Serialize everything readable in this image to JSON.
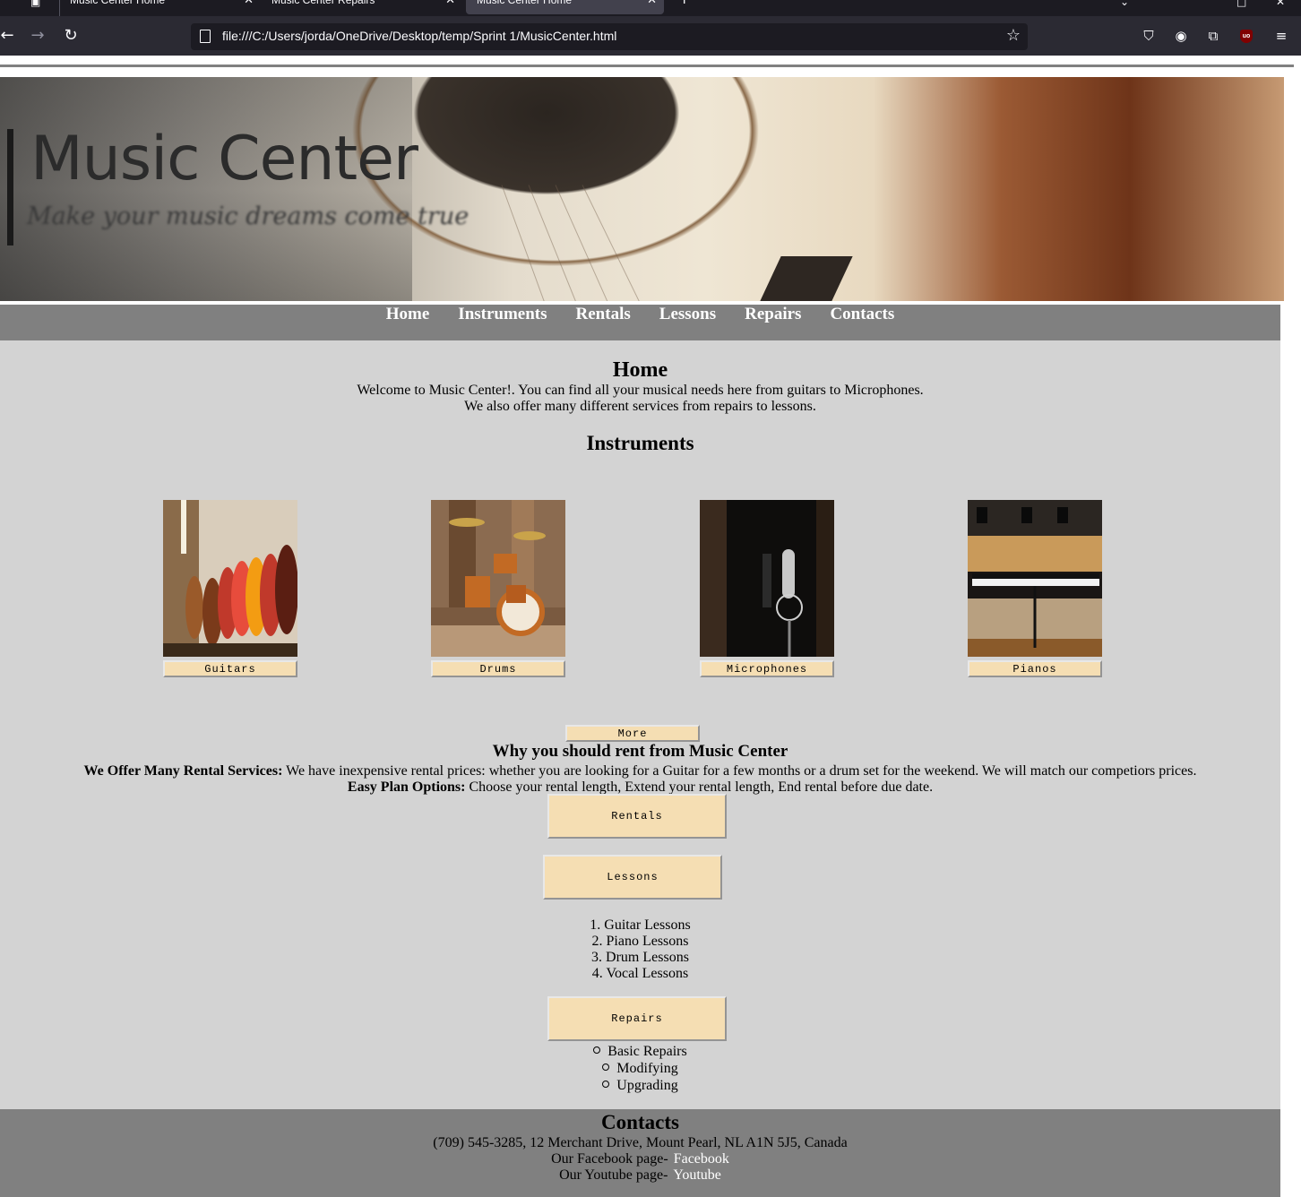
{
  "browser": {
    "tabs": [
      {
        "title": "Music Center Home",
        "active": false
      },
      {
        "title": "Music Center Repairs",
        "active": false
      },
      {
        "title": "Music Center Home",
        "active": true
      }
    ],
    "close_glyph": "✕",
    "new_tab_glyph": "+",
    "url": "file:///C:/Users/jorda/OneDrive/Desktop/temp/Sprint 1/MusicCenter.html",
    "icons": [
      "back-icon",
      "forward-icon",
      "reload-icon",
      "page-icon",
      "bookmark-star-icon",
      "pocket-icon",
      "account-icon",
      "extensions-icon",
      "ublock-icon",
      "menu-icon"
    ]
  },
  "banner": {
    "title": "Music Center",
    "tagline": "Make your music dreams come true"
  },
  "nav": {
    "items": [
      "Home",
      "Instruments",
      "Rentals",
      "Lessons",
      "Repairs",
      "Contacts"
    ]
  },
  "home": {
    "heading": "Home",
    "line1": "Welcome to Music Center!. You can find all your musical needs here from guitars to Microphones.",
    "line2": "We also offer many different services from repairs to lessons."
  },
  "instruments": {
    "heading": "Instruments",
    "items": [
      {
        "label": "Guitars"
      },
      {
        "label": "Drums"
      },
      {
        "label": "Microphones"
      },
      {
        "label": "Pianos"
      }
    ],
    "more_label": "More"
  },
  "rentals": {
    "heading": "Why you should rent from Music Center",
    "p1_bold": "We Offer Many Rental Services:",
    "p1_text": " We have inexpensive rental prices: whether you are looking for a Guitar for a few months or a drum set for the weekend. We will match our competiors prices.",
    "p2_bold": "Easy Plan Options:",
    "p2_text": " Choose your rental length, Extend your rental length, End rental before due date.",
    "button": "Rentals"
  },
  "lessons": {
    "button": "Lessons",
    "items": [
      "1. Guitar Lessons",
      "2. Piano Lessons",
      "3. Drum Lessons",
      "4. Vocal Lessons"
    ]
  },
  "repairs": {
    "button": "Repairs",
    "items": [
      "Basic Repairs",
      "Modifying",
      "Upgrading"
    ]
  },
  "contacts": {
    "heading": "Contacts",
    "address": "(709) 545-3285, 12 Merchant Drive, Mount Pearl, NL A1N 5J5, Canada",
    "facebook_prefix": "Our Facebook page-",
    "facebook_link": "Facebook",
    "youtube_prefix": "Our Youtube page-",
    "youtube_link": "Youtube"
  },
  "colors": {
    "chrome_dark": "#1c1b22",
    "toolbar": "#2b2a33",
    "nav_bg": "#808080",
    "content_bg": "#d3d3d3",
    "button_bg": "#f5deb3"
  }
}
